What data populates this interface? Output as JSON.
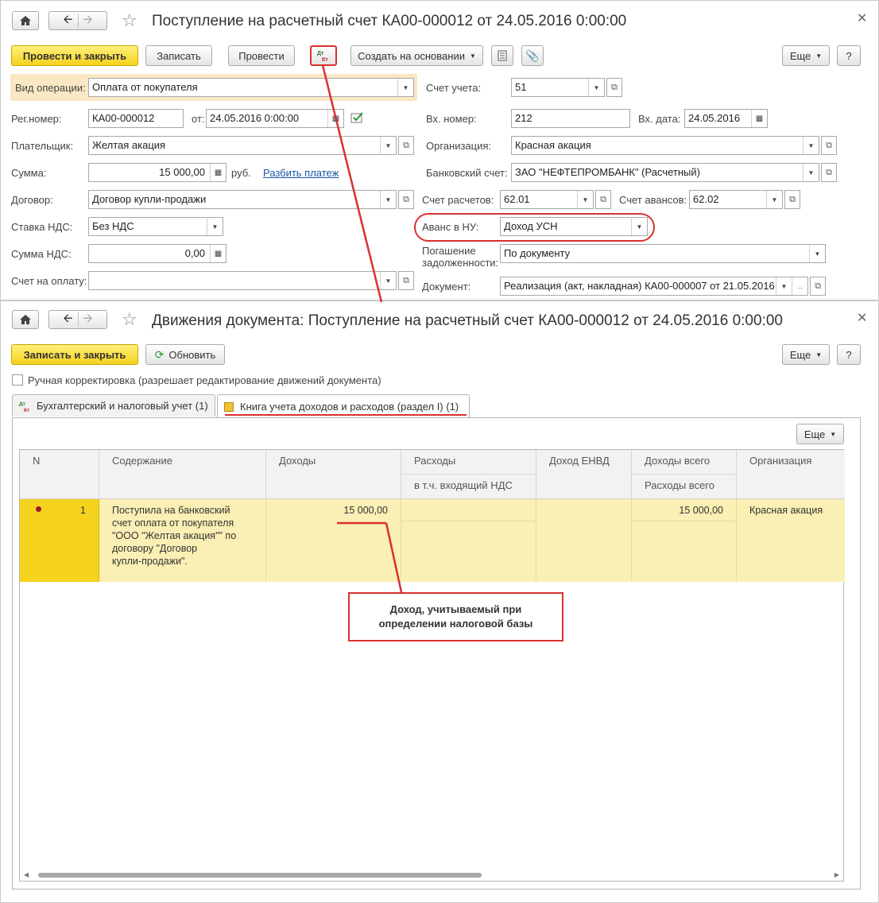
{
  "doc1": {
    "title": "Поступление на расчетный счет КА00-000012 от 24.05.2016 0:00:00",
    "toolbar": {
      "post_close": "Провести и закрыть",
      "save": "Записать",
      "post": "Провести",
      "create_based": "Создать на основании",
      "more": "Еще",
      "help": "?"
    },
    "form": {
      "operation_label": "Вид операции:",
      "operation_value": "Оплата от покупателя",
      "reg_label": "Рег.номер:",
      "reg_value": "КА00-000012",
      "date_label": "от:",
      "date_value": "24.05.2016  0:00:00",
      "payer_label": "Плательщик:",
      "payer_value": "Желтая акация",
      "sum_label": "Сумма:",
      "sum_value": "15 000,00",
      "currency": "руб.",
      "split_link": "Разбить платеж",
      "contract_label": "Договор:",
      "contract_value": "Договор купли-продажи",
      "vat_rate_label": "Ставка НДС:",
      "vat_rate_value": "Без НДС",
      "vat_sum_label": "Сумма НДС:",
      "vat_sum_value": "0,00",
      "invoice_label": "Счет на оплату:",
      "invoice_value": "",
      "account_label": "Счет учета:",
      "account_value": "51",
      "in_num_label": "Вх. номер:",
      "in_num_value": "212",
      "in_date_label": "Вх. дата:",
      "in_date_value": "24.05.2016",
      "org_label": "Организация:",
      "org_value": "Красная акация",
      "bank_label": "Банковский счет:",
      "bank_value": "ЗАО \"НЕФТЕПРОМБАНК\" (Расчетный)",
      "settle_label": "Счет расчетов:",
      "settle_value": "62.01",
      "advance_acc_label": "Счет авансов:",
      "advance_acc_value": "62.02",
      "advance_nu_label": "Аванс в НУ:",
      "advance_nu_value": "Доход УСН",
      "repay_label_1": "Погашение",
      "repay_label_2": "задолженности:",
      "repay_value": "По документу",
      "document_label": "Документ:",
      "document_value": "Реализация (акт, накладная) КА00-000007 от 21.05.2016"
    }
  },
  "doc2": {
    "title": "Движения документа: Поступление на расчетный счет КА00-000012 от 24.05.2016 0:00:00",
    "toolbar": {
      "save_close": "Записать и закрыть",
      "refresh": "Обновить",
      "more": "Еще",
      "help": "?"
    },
    "manual_label": "Ручная корректировка (разрешает редактирование движений документа)",
    "tabs": [
      {
        "label": "Бухгалтерский и налоговый учет (1)"
      },
      {
        "label": "Книга учета доходов и расходов (раздел I) (1)"
      }
    ],
    "grid_more": "Еще",
    "columns": {
      "n": "N",
      "content": "Содержание",
      "income": "Доходы",
      "expenses": "Расходы",
      "incl_vat": "в т.ч. входящий НДС",
      "envd": "Доход ЕНВД",
      "income_total": "Доходы всего",
      "expenses_total": "Расходы всего",
      "org": "Организация"
    },
    "rows": [
      {
        "n": "1",
        "content_1": "Поступила на банковский",
        "content_2": "счет оплата от покупателя",
        "content_3": "\"ООО \"Желтая акация\"\" по",
        "content_4": "договору \"Договор",
        "content_5": "купли-продажи\".",
        "income": "15 000,00",
        "income_total": "15 000,00",
        "org": "Красная акация"
      }
    ],
    "callout_1": "Доход, учитываемый при",
    "callout_2": "определении налоговой базы"
  },
  "icons": {
    "dt_kt": "Дт\nКт"
  },
  "colors": {
    "primary_button": "#f5d21e",
    "annotation_red": "#d93030",
    "row_highlight": "#faefb4",
    "operation_highlight": "#fae8c4"
  }
}
